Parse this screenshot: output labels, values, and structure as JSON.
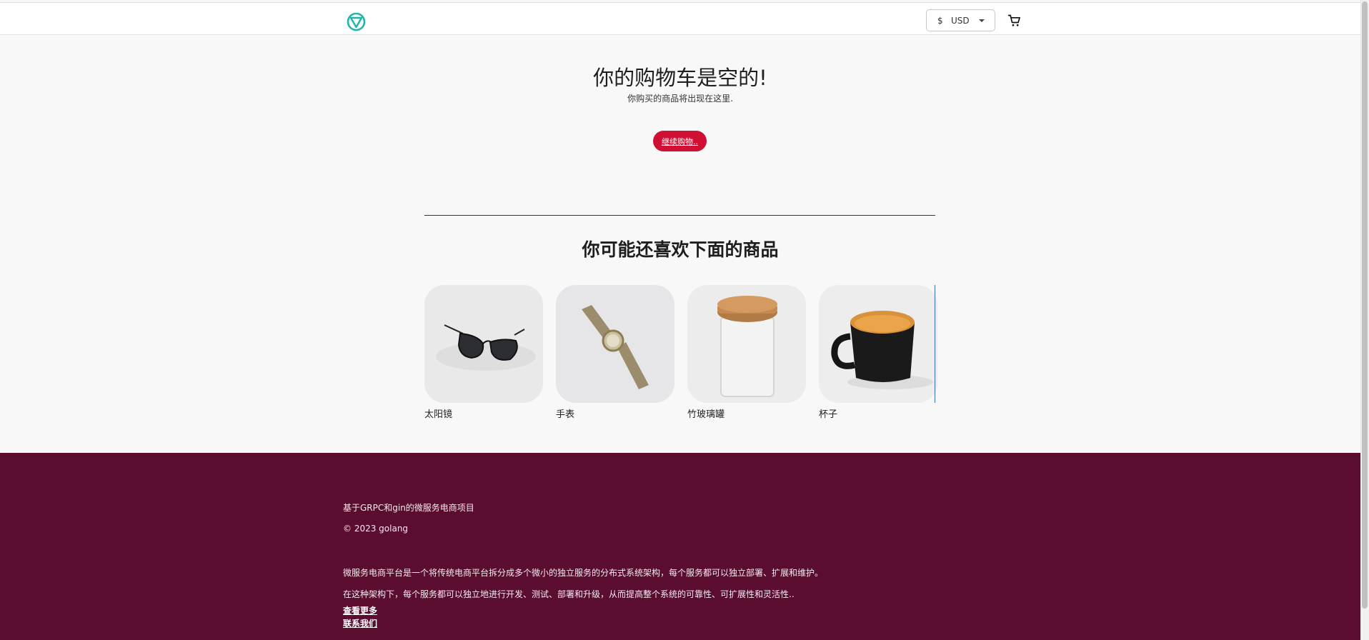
{
  "header": {
    "currency_symbol": "$",
    "currency_code": "USD",
    "logo_icon": "logo-icon",
    "cart_icon": "cart-icon"
  },
  "cart": {
    "empty_title": "你的购物车是空的!",
    "empty_subtitle": "你购买的商品将出现在这里.",
    "continue_label": "继续购物.."
  },
  "recommendations": {
    "title": "你可能还喜欢下面的商品",
    "items": [
      {
        "name": "太阳镜",
        "icon": "sunglasses-image"
      },
      {
        "name": "手表",
        "icon": "watch-image"
      },
      {
        "name": "竹玻璃罐",
        "icon": "bamboo-jar-image"
      },
      {
        "name": "杯子",
        "icon": "mug-image"
      }
    ]
  },
  "footer": {
    "project": "基于GRPC和gin的微服务电商项目",
    "copyright": "© 2023 golang",
    "desc1": "微服务电商平台是一个将传统电商平台拆分成多个微小的独立服务的分布式系统架构，每个服务都可以独立部署、扩展和维护。",
    "desc2": "在这种架构下，每个服务都可以独立地进行开发、测试、部署和升级，从而提高整个系统的可靠性、可扩展性和灵活性..",
    "more_link": "查看更多",
    "contact_link": "联系我们"
  },
  "colors": {
    "accent": "#cf0f33",
    "footer_bg": "#5a0d2f",
    "logo": "#1fb5a8"
  }
}
